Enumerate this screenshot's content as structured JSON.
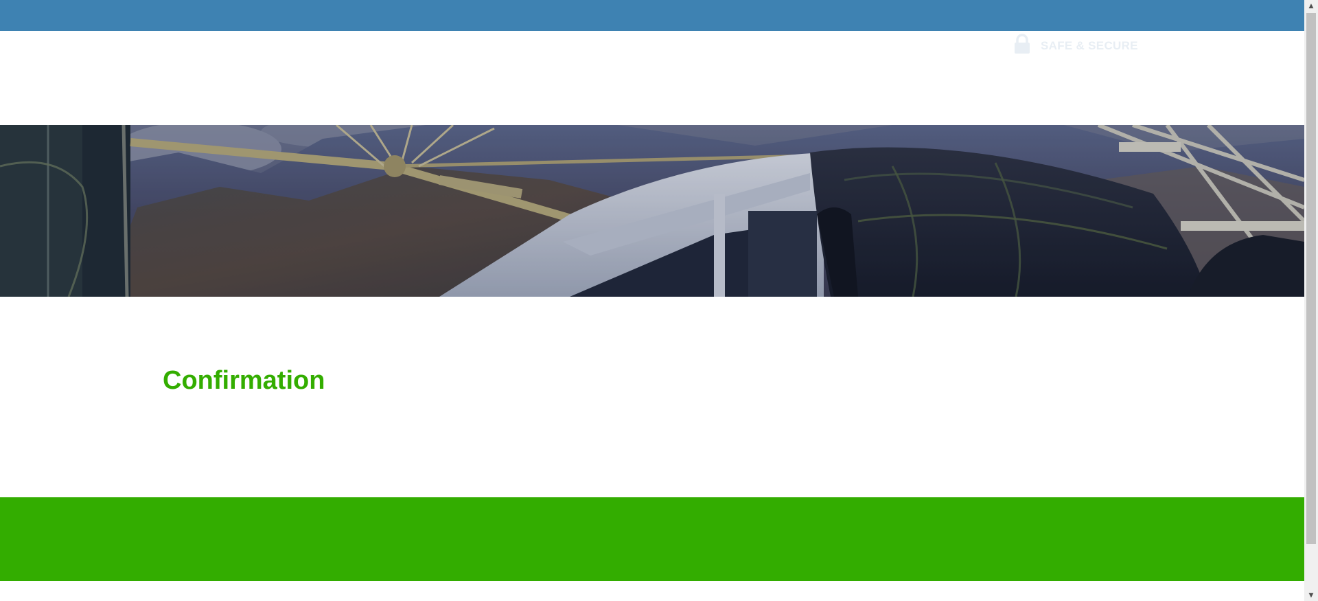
{
  "header": {
    "secure_label": "SAFE & SECURE",
    "lock_icon": "lock-icon"
  },
  "main": {
    "title": "Confirmation"
  },
  "colors": {
    "top_bar": "#3e82b2",
    "footer": "#33ad00",
    "title": "#33ad00",
    "secure_badge": "#e8eef4"
  },
  "hero": {
    "image_subject": "coach bus under cable structure with mountains"
  },
  "scrollbar": {
    "up_icon": "scroll-up-arrow",
    "down_icon": "scroll-down-arrow"
  }
}
